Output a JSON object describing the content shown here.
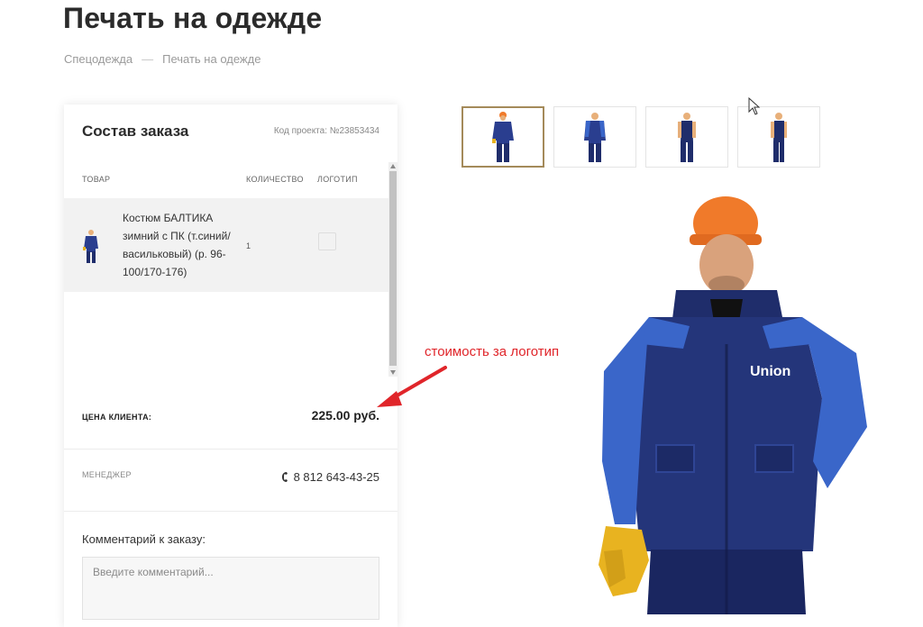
{
  "page": {
    "title": "Печать на одежде",
    "breadcrumb": [
      "Спецодежда",
      "Печать на одежде"
    ],
    "breadcrumb_separator": "—"
  },
  "order": {
    "title": "Состав заказа",
    "project_code": "Код проекта: №23853434",
    "columns": {
      "product": "ТОВАР",
      "quantity": "КОЛИЧЕСТВО",
      "logo": "ЛОГОТИП"
    },
    "items": [
      {
        "name": "Костюм БАЛТИКА зимний с ПК (т.синий/васильковый) (р. 96-100/170-176)",
        "quantity": "1",
        "logo_checked": false
      }
    ],
    "price_label": "ЦЕНА КЛИЕНТА:",
    "price_value": "225.00 руб.",
    "manager_label": "МЕНЕДЖЕР",
    "manager_phone": "8 812 643-43-25",
    "comment_label": "Комментарий к заказу:",
    "comment_placeholder": "Введите комментарий..."
  },
  "annotation": {
    "text": "стоимость за логотип",
    "color": "#e0252a"
  },
  "gallery": {
    "thumbnail_count": 4,
    "active_index": 0
  },
  "hero": {
    "logo_text": "Union"
  },
  "colors": {
    "accent_border": "#a48a5a",
    "jacket_dark": "#1f2d6b",
    "jacket_light": "#3a66c9",
    "helmet": "#f07a2a",
    "gloves": "#e8b320"
  }
}
